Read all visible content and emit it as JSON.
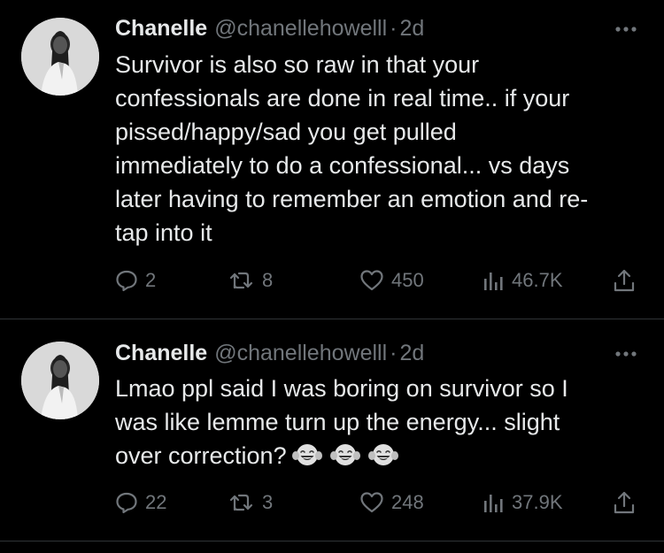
{
  "colors": {
    "background": "#000000",
    "text_primary": "#e7e9ea",
    "text_secondary": "#71767b",
    "divider": "#2f3336"
  },
  "tweets": [
    {
      "author": {
        "display_name": "Chanelle",
        "handle": "@chanellehowelll",
        "separator": "·",
        "time": "2d"
      },
      "text": "Survivor is also so raw in that your\nconfessionals are done in real time.. if your\npissed/happy/sad you get pulled\nimmediately to do a confessional... vs days\nlater having to remember an emotion and re-\ntap into it",
      "emoji_icon": "",
      "stats": {
        "replies": "2",
        "reposts": "8",
        "likes": "450",
        "views": "46.7K"
      }
    },
    {
      "author": {
        "display_name": "Chanelle",
        "handle": "@chanellehowelll",
        "separator": "·",
        "time": "2d"
      },
      "text": "Lmao ppl said I was boring on survivor so I\nwas like lemme turn up the energy... slight\nover correction?",
      "emoji_icon": "tears-of-joy-emoji-icon",
      "stats": {
        "replies": "22",
        "reposts": "3",
        "likes": "248",
        "views": "37.9K"
      }
    }
  ]
}
